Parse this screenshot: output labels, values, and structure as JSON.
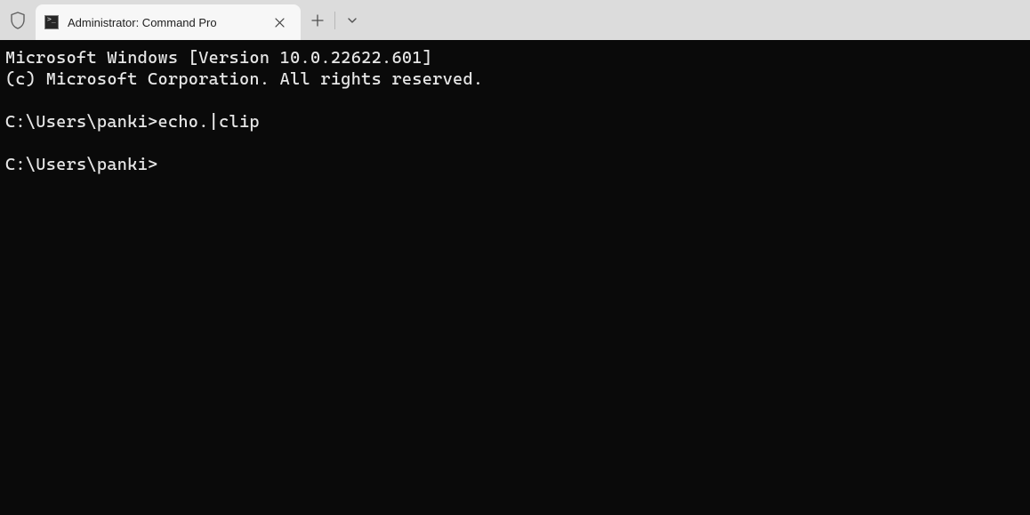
{
  "titlebar": {
    "tab": {
      "title": "Administrator: Command Pro"
    }
  },
  "terminal": {
    "lines": [
      "Microsoft Windows [Version 10.0.22622.601]",
      "(c) Microsoft Corporation. All rights reserved.",
      "",
      "C:\\Users\\panki>echo.|clip",
      "",
      "C:\\Users\\panki>"
    ]
  }
}
